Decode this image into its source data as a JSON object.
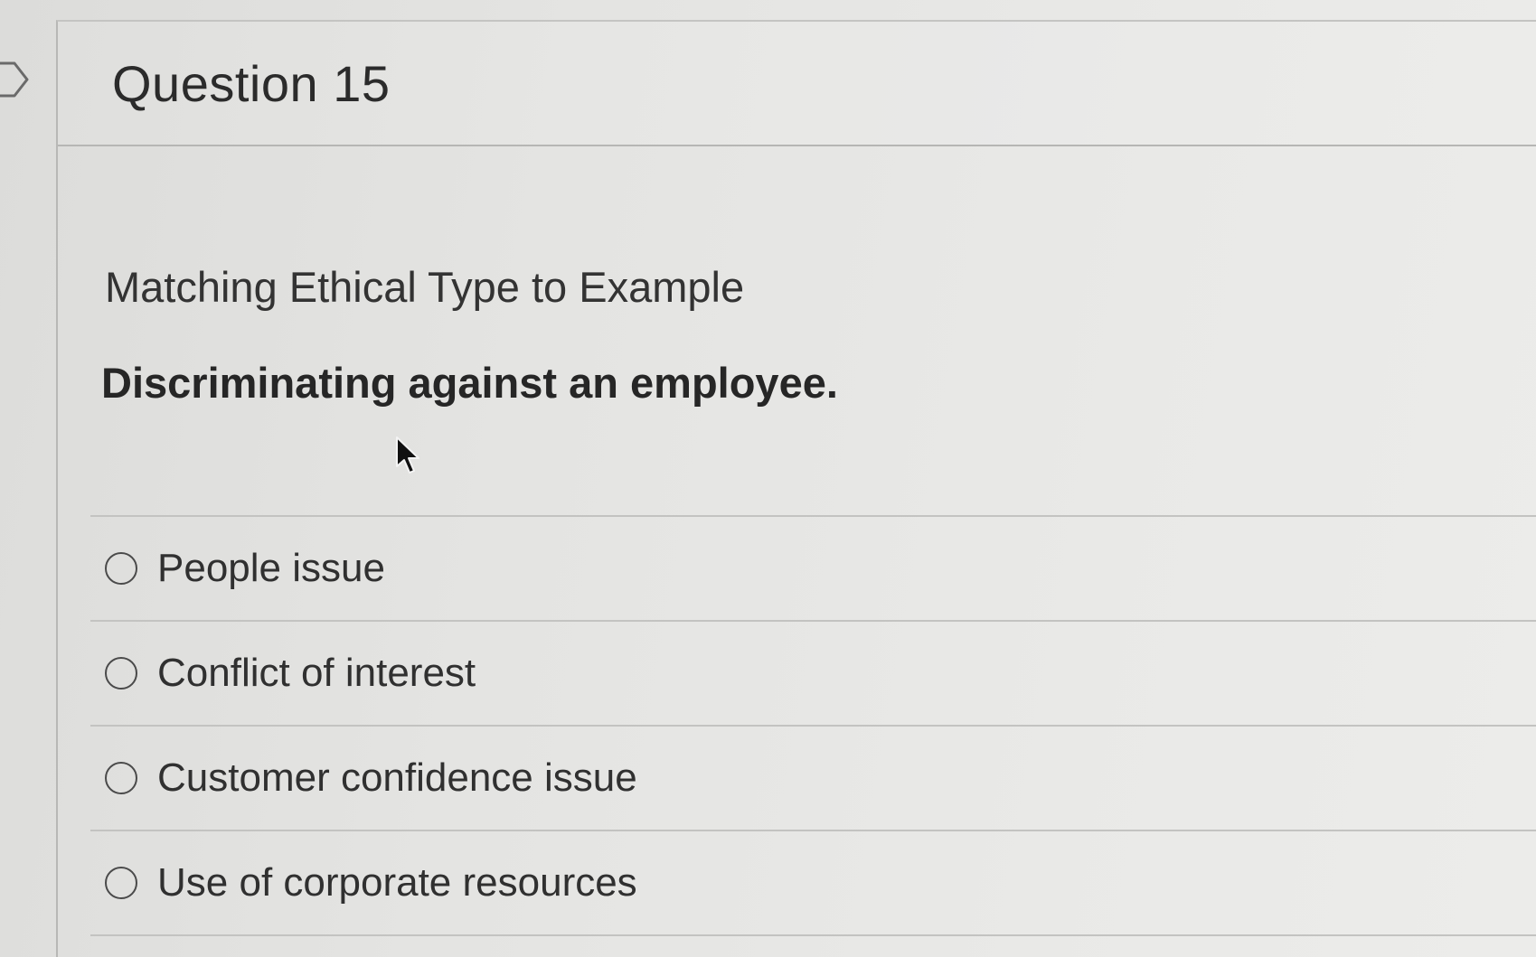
{
  "question": {
    "title": "Question 15",
    "prompt": "Matching Ethical Type to Example",
    "stem": "Discriminating against an employee.",
    "options": [
      {
        "label": "People issue",
        "selected": false
      },
      {
        "label": "Conflict of interest",
        "selected": false
      },
      {
        "label": "Customer confidence issue",
        "selected": false
      },
      {
        "label": "Use of corporate resources",
        "selected": false
      }
    ]
  },
  "icons": {
    "collapse_toggle": "chevron-right-icon",
    "cursor": "mouse-pointer-icon",
    "option_control": "radio-button"
  },
  "colors": {
    "background": "#e6e6e4",
    "text": "#2b2b2b",
    "divider": "#c3c3c1"
  }
}
